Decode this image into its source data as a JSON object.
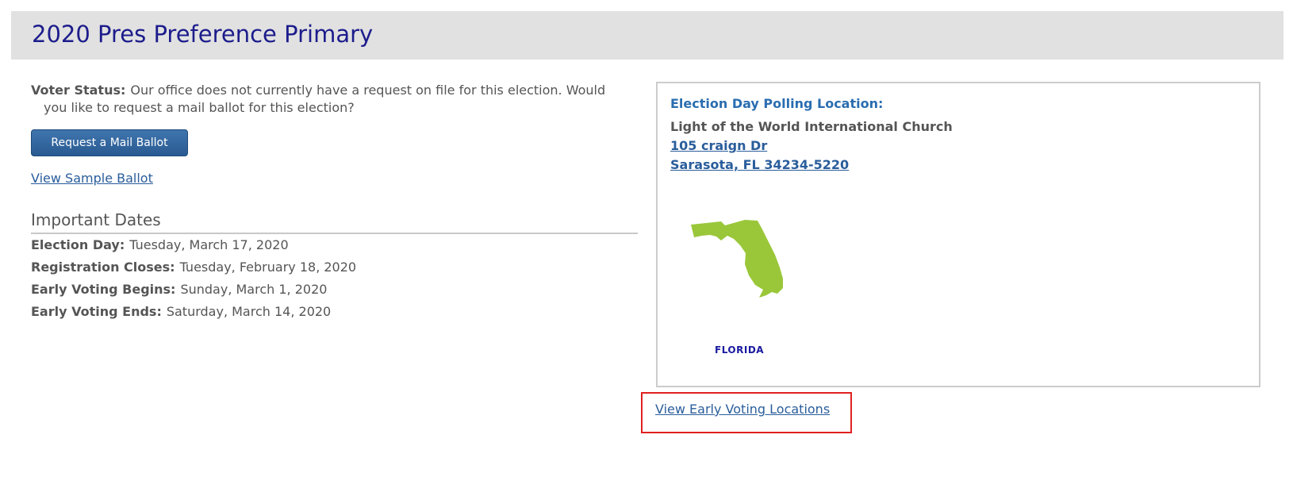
{
  "header": {
    "title": "2020 Pres Preference Primary"
  },
  "voter_status": {
    "label": "Voter Status:",
    "text": "Our office does not currently have a request on file for this election. Would you like to request a mail ballot for this election?"
  },
  "actions": {
    "request_mail_ballot": "Request a Mail Ballot",
    "view_sample_ballot": "View Sample Ballot"
  },
  "important_dates": {
    "heading": "Important Dates",
    "rows": [
      {
        "label": "Election Day:",
        "value": "Tuesday, March 17, 2020"
      },
      {
        "label": "Registration Closes:",
        "value": "Tuesday, February 18, 2020"
      },
      {
        "label": "Early Voting Begins:",
        "value": "Sunday, March 1, 2020"
      },
      {
        "label": "Early Voting Ends:",
        "value": "Saturday, March 14, 2020"
      }
    ]
  },
  "polling_location": {
    "title": "Election Day Polling Location:",
    "name": "Light of the World International Church",
    "address_line1": "105 craign Dr",
    "address_line2": "Sarasota, FL 34234-5220",
    "map_label": "FLORIDA",
    "map_color": "#9ac73a"
  },
  "early_voting": {
    "link": "View Early Voting Locations"
  },
  "colors": {
    "header_bg": "#e1e1e1",
    "title": "#1c1c8c",
    "link": "#2a5d9b",
    "button": "#2a5a92",
    "highlight_box": "#e02020"
  }
}
